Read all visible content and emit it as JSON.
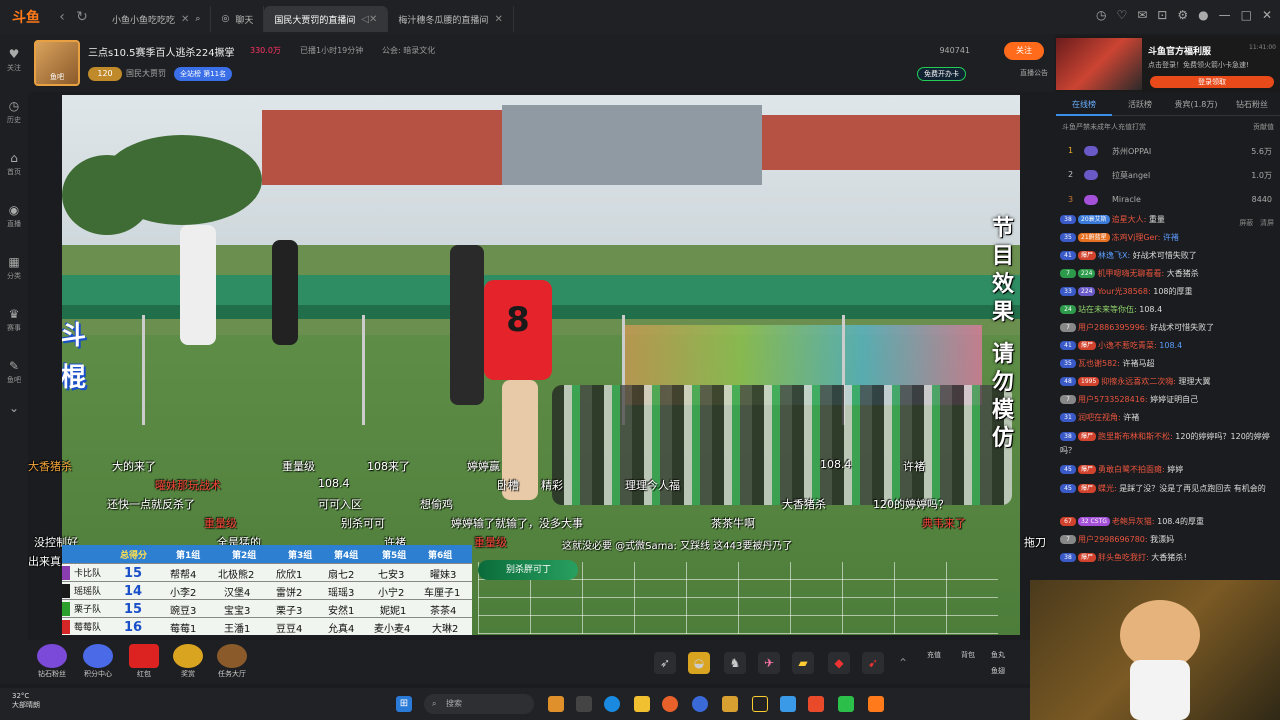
{
  "tabs": {
    "logo": "斗鱼",
    "items": [
      {
        "label": "小鱼小鱼吃吃吃"
      },
      {
        "label": "聊天"
      },
      {
        "label": "国民大贾罚的直播间"
      },
      {
        "label": "梅汁穗冬瓜腰的直播间"
      }
    ]
  },
  "sidebar": {
    "items": [
      {
        "label": "关注",
        "icon": "heart-icon"
      },
      {
        "label": "历史",
        "icon": "clock-icon"
      },
      {
        "label": "首页",
        "icon": "home-icon"
      },
      {
        "label": "直播",
        "icon": "broadcast-icon"
      },
      {
        "label": "分类",
        "icon": "grid-icon"
      },
      {
        "label": "赛事",
        "icon": "trophy-icon"
      },
      {
        "label": "鱼吧",
        "icon": "chat-icon"
      }
    ]
  },
  "header": {
    "avatar_text": "鱼吧",
    "title": "三点s10.5赛季百人逃杀224撅掌",
    "hot": "330.0万",
    "live_time": "已播1小时19分钟",
    "notice": "公会: 暗录文化",
    "level": "120",
    "streamer": "国民大贾罚",
    "rank": "全站榜 第11名",
    "room_id": "940741",
    "follow": "关注",
    "free_card": "免费开办卡",
    "room_notice": "直播公告"
  },
  "video": {
    "jersey_number": "8",
    "side_text": [
      "节",
      "目",
      "效",
      "果",
      "请",
      "勿",
      "模",
      "仿"
    ],
    "logo_text": [
      "斗",
      "棍"
    ],
    "danmaku": [
      {
        "text": "大香猪杀",
        "color": "#f2a23a"
      },
      {
        "text": "大的来了",
        "color": "#ffffff"
      },
      {
        "text": "重量级",
        "color": "#ffffff"
      },
      {
        "text": "108来了",
        "color": "#ffffff"
      },
      {
        "text": "婷婷赢",
        "color": "#ffffff"
      },
      {
        "text": "108.4",
        "color": "#ffffff"
      },
      {
        "text": "许褚",
        "color": "#ffffff"
      },
      {
        "text": "曜妹那玩战术",
        "color": "#f44336"
      },
      {
        "text": "108.4",
        "color": "#ffffff"
      },
      {
        "text": "卧槽",
        "color": "#ffffff"
      },
      {
        "text": "精彩",
        "color": "#ffffff"
      },
      {
        "text": "理理今人福",
        "color": "#ffffff"
      },
      {
        "text": "还快一点就反杀了",
        "color": "#ffffff"
      },
      {
        "text": "可可入区",
        "color": "#ffffff"
      },
      {
        "text": "想偷鸡",
        "color": "#ffffff"
      },
      {
        "text": "大香猪杀",
        "color": "#ffffff"
      },
      {
        "text": "120的婷婷吗？",
        "color": "#ffffff"
      },
      {
        "text": "重量级",
        "color": "#f44336"
      },
      {
        "text": "别杀可可",
        "color": "#ffffff"
      },
      {
        "text": "婷婷输了就输了，没多大事",
        "color": "#ffffff"
      },
      {
        "text": "茶茶牛啊",
        "color": "#ffffff"
      },
      {
        "text": "典韦来了",
        "color": "#f44336"
      },
      {
        "text": "没控制好",
        "color": "#ffffff"
      },
      {
        "text": "全是猛的",
        "color": "#ffffff"
      },
      {
        "text": "许褚",
        "color": "#ffffff"
      },
      {
        "text": "重量级",
        "color": "#f44336"
      },
      {
        "text": "这就没必要 @式微Sama: 又踩线 这443要被丹乃了",
        "color": "#ffffff"
      },
      {
        "text": "出来真反杀",
        "color": "#ffffff"
      },
      {
        "text": "拖刀",
        "color": "#ffffff"
      }
    ],
    "kill_banner": "别杀胖可丁"
  },
  "score": {
    "header": [
      "总得分",
      "第1组",
      "第2组",
      "第3组",
      "第4组",
      "第5组",
      "第6组"
    ],
    "rows": [
      {
        "team": "卡比队",
        "color": "#8a3db0",
        "score": "15",
        "members": [
          "帮帮4",
          "北极熊2",
          "欣欣1",
          "扇七2",
          "七安3",
          "曜妹3"
        ]
      },
      {
        "team": "瑶瑶队",
        "color": "#1a1a1a",
        "score": "14",
        "members": [
          "小李2",
          "汉堡4",
          "雷饼2",
          "瑶瑶3",
          "小宁2",
          "车厘子1"
        ]
      },
      {
        "team": "栗子队",
        "color": "#2ca02c",
        "score": "15",
        "members": [
          "豌豆3",
          "宝宝3",
          "栗子3",
          "安然1",
          "妮妮1",
          "茶茶4"
        ]
      },
      {
        "team": "莓莓队",
        "color": "#d62728",
        "score": "16",
        "members": [
          "莓莓1",
          "王潘1",
          "豆豆4",
          "允真4",
          "麦小麦4",
          "大琳2"
        ]
      }
    ]
  },
  "bottombar": {
    "items": [
      {
        "label": "钻石粉丝"
      },
      {
        "label": "积分中心"
      },
      {
        "label": "红包"
      },
      {
        "label": "奖赏"
      },
      {
        "label": "任务大厅"
      }
    ],
    "recharge": "充值",
    "backpack": "背包",
    "fish_ball": "鱼丸",
    "fish_wing": "鱼翅"
  },
  "chat": {
    "ad_title": "斗鱼官方福利服",
    "ad_sub": "点击登录！免费领火箭小卡急速!",
    "ad_btn": "登录领取",
    "ad_time": "11:41:00",
    "tabs": [
      "在线榜",
      "活跃榜",
      "贵宾(1.8万)",
      "钻石粉丝"
    ],
    "sub_left": "斗鱼严禁未成年人充值打赏",
    "sub_right": "贡献值",
    "leaderboard": [
      {
        "rank": "1",
        "name": "苏州OPPAI",
        "value": "5.6万"
      },
      {
        "rank": "2",
        "name": "拉莫angel",
        "value": "1.0万"
      },
      {
        "rank": "3",
        "name": "Miracle",
        "value": "8440"
      }
    ],
    "toolbar": [
      "屏蔽",
      "清屏"
    ],
    "messages": [
      {
        "lvl": "38",
        "badge": "20衰艾斯",
        "nick": "追星大人:",
        "text": "重量"
      },
      {
        "lvl": "35",
        "badge": "21蔚蓝星",
        "nick": "冻鸡Vj理Ger:",
        "text": "许褚"
      },
      {
        "lvl": "41",
        "badge": "爆尸",
        "nick": "林逸飞X:",
        "text": "好战术可惜失败了"
      },
      {
        "lvl": "7",
        "badge": "224",
        "nick": "机甲嗯嗨无聊看看:",
        "text": "大香猪杀"
      },
      {
        "lvl": "33",
        "badge": "224",
        "nick": "Your光38568:",
        "text": "108的厚重"
      },
      {
        "lvl": "24",
        "badge": "",
        "nick": "站在未来等你伍:",
        "text": "108.4"
      },
      {
        "lvl": "7",
        "badge": "",
        "nick": "用户2886395996:",
        "text": "好战术可惜失败了"
      },
      {
        "lvl": "41",
        "badge": "爆尸",
        "nick": "小逸不惹吃青菜:",
        "text": "108.4"
      },
      {
        "lvl": "35",
        "badge": "",
        "nick": "瓦也谢582:",
        "text": "许褚马超"
      },
      {
        "lvl": "48",
        "badge": "1995",
        "nick": "抑擦永远喜欢二次嗨:",
        "text": "理理大翼"
      },
      {
        "lvl": "7",
        "badge": "",
        "nick": "用户5733528416:",
        "text": "婷婷证明自己"
      },
      {
        "lvl": "31",
        "badge": "",
        "nick": "润吧在视角:",
        "text": "许褚"
      },
      {
        "lvl": "38",
        "badge": "爆尸",
        "nick": "跑里斯布林和斯不松:",
        "text": "120的婷婷吗？120的婷婷吗？"
      },
      {
        "lvl": "45",
        "badge": "爆尸",
        "nick": "勇敢白鹭不拍面瘫:",
        "text": "婷婷"
      },
      {
        "lvl": "45",
        "badge": "爆尸",
        "nick": "蝶光:",
        "text": "是踩了没？没是了再见点跑回去 有机会的"
      },
      {
        "lvl": "67",
        "badge": "32 CSTG",
        "nick": "老鲍异灰猫:",
        "text": "108.4的厚重"
      },
      {
        "lvl": "7",
        "badge": "",
        "nick": "用户2998696780:",
        "text": "我漂妈"
      },
      {
        "lvl": "38",
        "badge": "爆尸",
        "nick": "胖头鱼吃我打:",
        "text": "大香猪杀！"
      }
    ]
  },
  "taskbar": {
    "temp": "32°C",
    "weather": "大部晴朗",
    "search": "搜索"
  }
}
